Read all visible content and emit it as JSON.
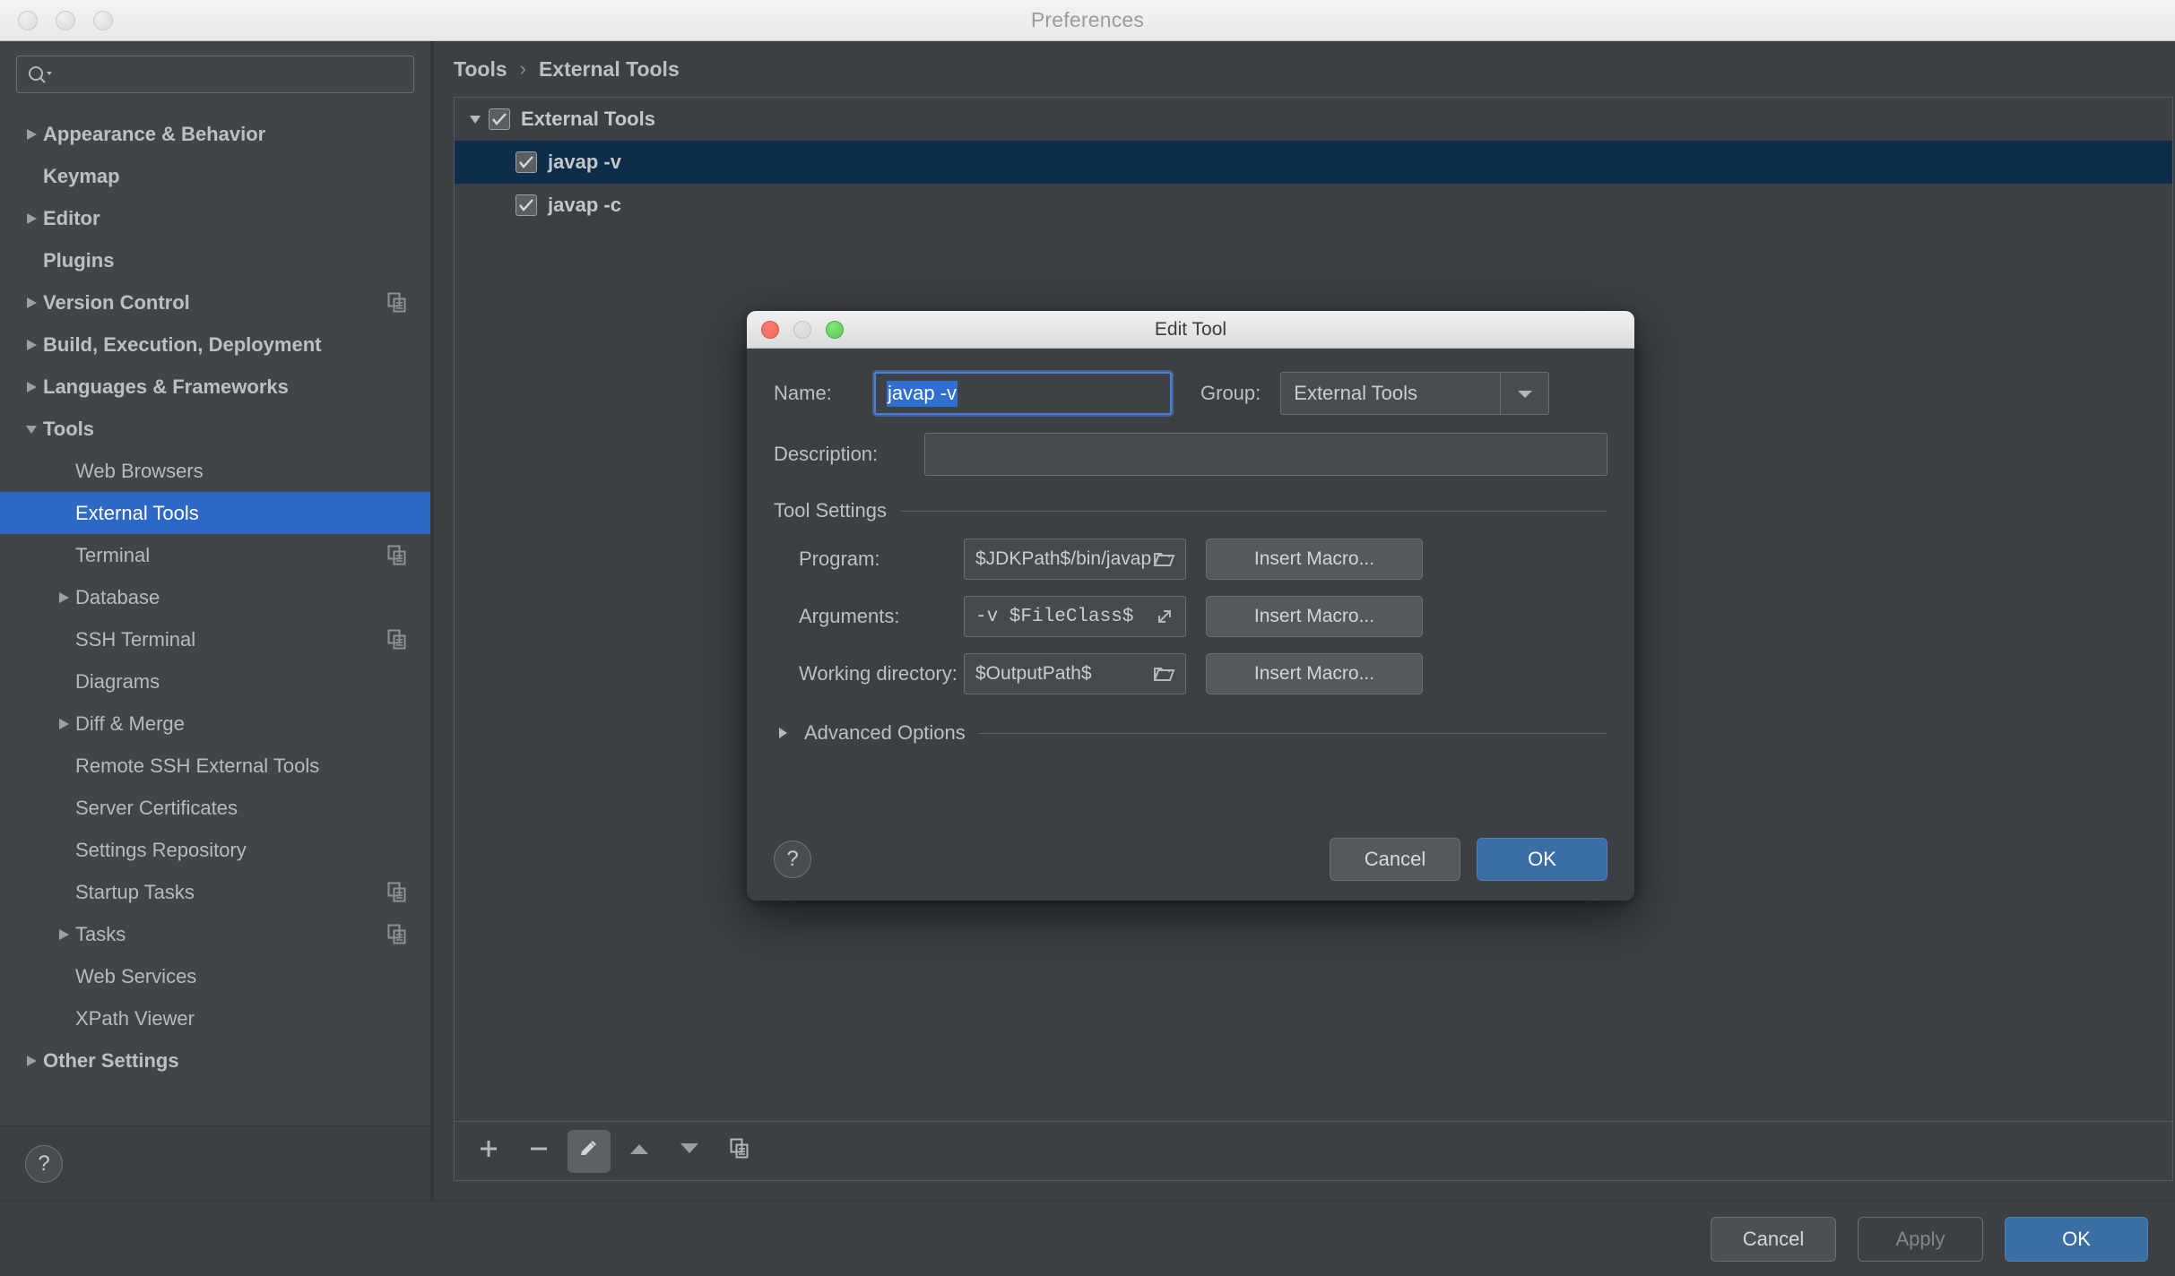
{
  "window": {
    "title": "Preferences",
    "traffic_lights": [
      "close-inactive",
      "minimize-inactive",
      "zoom-inactive"
    ]
  },
  "search": {
    "value": "",
    "placeholder": "",
    "icon": "search-icon"
  },
  "sidebar": {
    "items": [
      {
        "label": "Appearance & Behavior",
        "arrow": "right",
        "bold": true,
        "indent": 0,
        "badge": false
      },
      {
        "label": "Keymap",
        "arrow": "none",
        "bold": true,
        "indent": 0,
        "badge": false
      },
      {
        "label": "Editor",
        "arrow": "right",
        "bold": true,
        "indent": 0,
        "badge": false
      },
      {
        "label": "Plugins",
        "arrow": "none",
        "bold": true,
        "indent": 0,
        "badge": false
      },
      {
        "label": "Version Control",
        "arrow": "right",
        "bold": true,
        "indent": 0,
        "badge": true
      },
      {
        "label": "Build, Execution, Deployment",
        "arrow": "right",
        "bold": true,
        "indent": 0,
        "badge": false
      },
      {
        "label": "Languages & Frameworks",
        "arrow": "right",
        "bold": true,
        "indent": 0,
        "badge": false
      },
      {
        "label": "Tools",
        "arrow": "down",
        "bold": true,
        "indent": 0,
        "badge": false
      },
      {
        "label": "Web Browsers",
        "arrow": "none",
        "bold": false,
        "indent": 1,
        "badge": false
      },
      {
        "label": "External Tools",
        "arrow": "none",
        "bold": false,
        "indent": 1,
        "badge": false,
        "selected": true
      },
      {
        "label": "Terminal",
        "arrow": "none",
        "bold": false,
        "indent": 1,
        "badge": true
      },
      {
        "label": "Database",
        "arrow": "right",
        "bold": false,
        "indent": 1,
        "badge": false
      },
      {
        "label": "SSH Terminal",
        "arrow": "none",
        "bold": false,
        "indent": 1,
        "badge": true
      },
      {
        "label": "Diagrams",
        "arrow": "none",
        "bold": false,
        "indent": 1,
        "badge": false
      },
      {
        "label": "Diff & Merge",
        "arrow": "right",
        "bold": false,
        "indent": 1,
        "badge": false
      },
      {
        "label": "Remote SSH External Tools",
        "arrow": "none",
        "bold": false,
        "indent": 1,
        "badge": false
      },
      {
        "label": "Server Certificates",
        "arrow": "none",
        "bold": false,
        "indent": 1,
        "badge": false
      },
      {
        "label": "Settings Repository",
        "arrow": "none",
        "bold": false,
        "indent": 1,
        "badge": false
      },
      {
        "label": "Startup Tasks",
        "arrow": "none",
        "bold": false,
        "indent": 1,
        "badge": true
      },
      {
        "label": "Tasks",
        "arrow": "right",
        "bold": false,
        "indent": 1,
        "badge": true
      },
      {
        "label": "Web Services",
        "arrow": "none",
        "bold": false,
        "indent": 1,
        "badge": false
      },
      {
        "label": "XPath Viewer",
        "arrow": "none",
        "bold": false,
        "indent": 1,
        "badge": false
      },
      {
        "label": "Other Settings",
        "arrow": "right",
        "bold": true,
        "indent": 0,
        "badge": false
      }
    ],
    "help_label": "?"
  },
  "main": {
    "breadcrumb": {
      "parent": "Tools",
      "separator": "›",
      "current": "External Tools"
    },
    "tree": [
      {
        "label": "External Tools",
        "arrow": "down",
        "checked": true,
        "indent": 0,
        "selected": false
      },
      {
        "label": "javap -v",
        "arrow": "none",
        "checked": true,
        "indent": 1,
        "selected": true
      },
      {
        "label": "javap -c",
        "arrow": "none",
        "checked": true,
        "indent": 1,
        "selected": false
      }
    ],
    "toolbar": [
      {
        "name": "add-button",
        "icon": "plus-icon",
        "active": false
      },
      {
        "name": "remove-button",
        "icon": "minus-icon",
        "active": false
      },
      {
        "name": "edit-button",
        "icon": "pencil-icon",
        "active": true
      },
      {
        "name": "move-up-button",
        "icon": "triangle-up-icon",
        "active": false
      },
      {
        "name": "move-down-button",
        "icon": "triangle-down-icon",
        "active": false
      },
      {
        "name": "copy-button",
        "icon": "copy-icon",
        "active": false
      }
    ]
  },
  "footer": {
    "cancel": "Cancel",
    "apply": "Apply",
    "ok": "OK"
  },
  "dialog": {
    "title": "Edit Tool",
    "name_label": "Name:",
    "name_value": "javap -v",
    "group_label": "Group:",
    "group_value": "External Tools",
    "description_label": "Description:",
    "description_value": "",
    "tool_settings_title": "Tool Settings",
    "settings": [
      {
        "label": "Program:",
        "value": "$JDKPath$/bin/javap",
        "icon": "folder-icon",
        "mono": false,
        "macro": "Insert Macro..."
      },
      {
        "label": "Arguments:",
        "value": "-v $FileClass$",
        "icon": "expand-icon",
        "mono": true,
        "macro": "Insert Macro..."
      },
      {
        "label": "Working directory:",
        "value": "$OutputPath$",
        "icon": "folder-icon",
        "mono": false,
        "macro": "Insert Macro..."
      }
    ],
    "advanced_options": "Advanced Options",
    "help_label": "?",
    "cancel": "Cancel",
    "ok": "OK"
  },
  "colors": {
    "window_bg": "#3c4043",
    "sidebar_bg": "#41454a",
    "selection_blue": "#2d68c4",
    "tree_selection_navy": "#0d2d4a",
    "primary_button": "#3a6ea5",
    "text_input_selection": "#2f6fd0",
    "focus_ring": "#4b7fd4"
  }
}
